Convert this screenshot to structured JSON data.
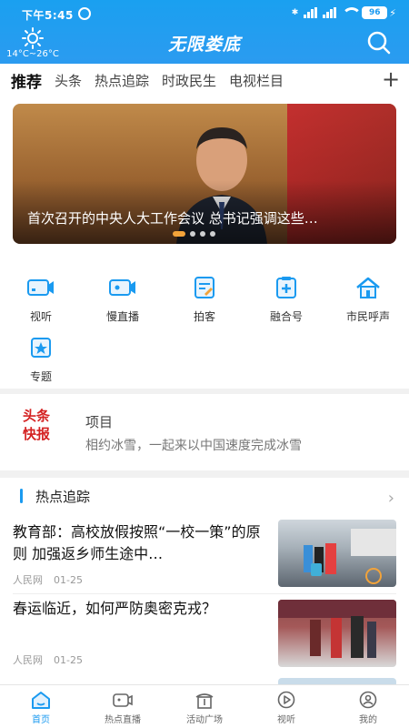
{
  "status_bar": {
    "time": "下午5:45",
    "battery": "96"
  },
  "header": {
    "app_title": "无限娄底",
    "temperature": "14°C~26°C"
  },
  "tabs": [
    "推荐",
    "头条",
    "热点追踪",
    "时政民生",
    "电视栏目"
  ],
  "banner": {
    "caption": "首次召开的中央人大工作会议 总书记强调这些…"
  },
  "quick_links": [
    "视听",
    "慢直播",
    "拍客",
    "融合号",
    "市民呼声",
    "专题"
  ],
  "ticker": {
    "logo_line1": "头条",
    "logo_line2": "快报",
    "lines": [
      "项目",
      "相约冰雪，一起来以中国速度完成冰雪"
    ]
  },
  "section": {
    "title": "热点追踪"
  },
  "news": [
    {
      "headline": "教育部：高校放假按照“一校一策”的原则 加强返乡师生途中…",
      "source": "人民网",
      "date": "01-25"
    },
    {
      "headline": "春运临近，如何严防奥密克戎？",
      "source": "人民网",
      "date": "01-25"
    }
  ],
  "bottom_nav": [
    "首页",
    "热点直播",
    "活动广场",
    "视听",
    "我的"
  ],
  "colors": {
    "accent": "#1a9af0",
    "ticker_logo": "#d42222"
  }
}
